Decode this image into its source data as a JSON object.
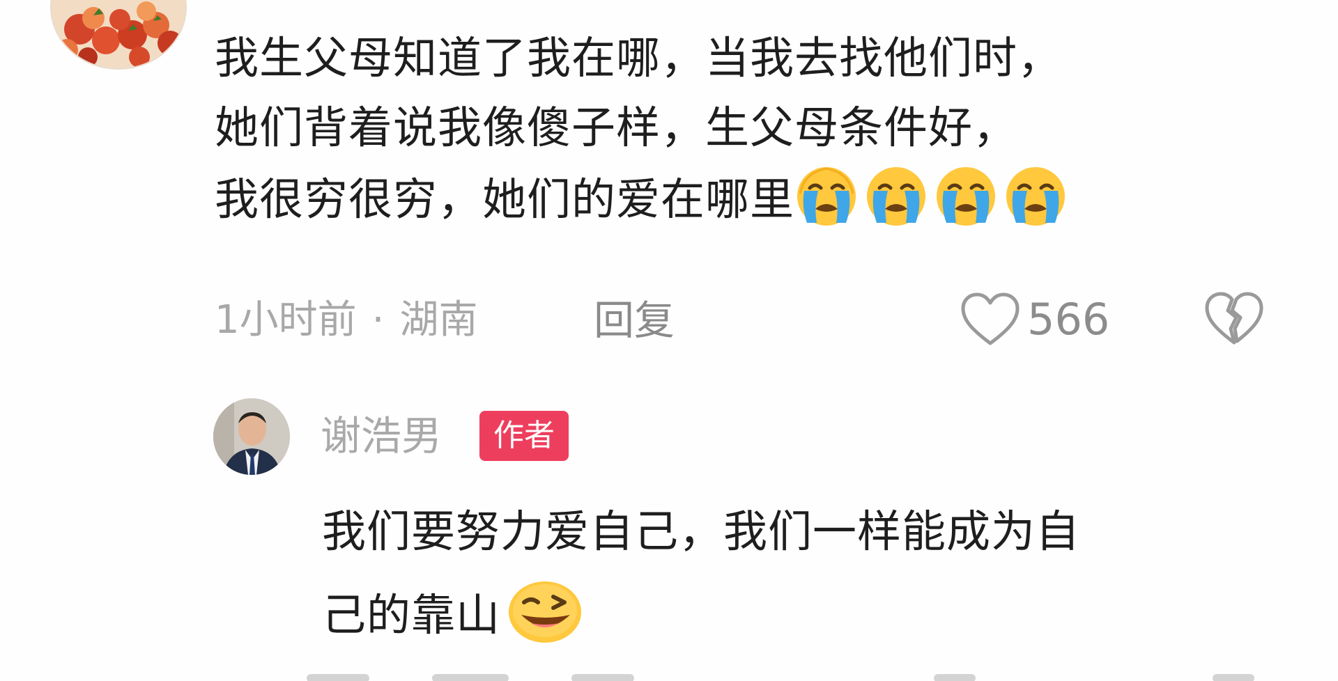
{
  "comment": {
    "lines": [
      "我生父母知道了我在哪，当我去找他们时，",
      "她们背着说我像傻子样，生父母条件好，",
      "我很穷很穷，她们的爱在哪里"
    ],
    "emojis": [
      "crying-face",
      "crying-face",
      "crying-face",
      "crying-face"
    ],
    "time": "1小时前",
    "separator": "·",
    "location": "湖南",
    "reply_label": "回复",
    "like_count": "566"
  },
  "reply": {
    "author": "谢浩男",
    "badge": "作者",
    "lines": [
      "我们要努力爱自己，我们一样能成为自",
      "己的靠山"
    ],
    "emoji": "winking-face"
  },
  "colors": {
    "text": "#1e1e1e",
    "muted": "#a8a8a8",
    "badge": "#ee3e5e"
  }
}
